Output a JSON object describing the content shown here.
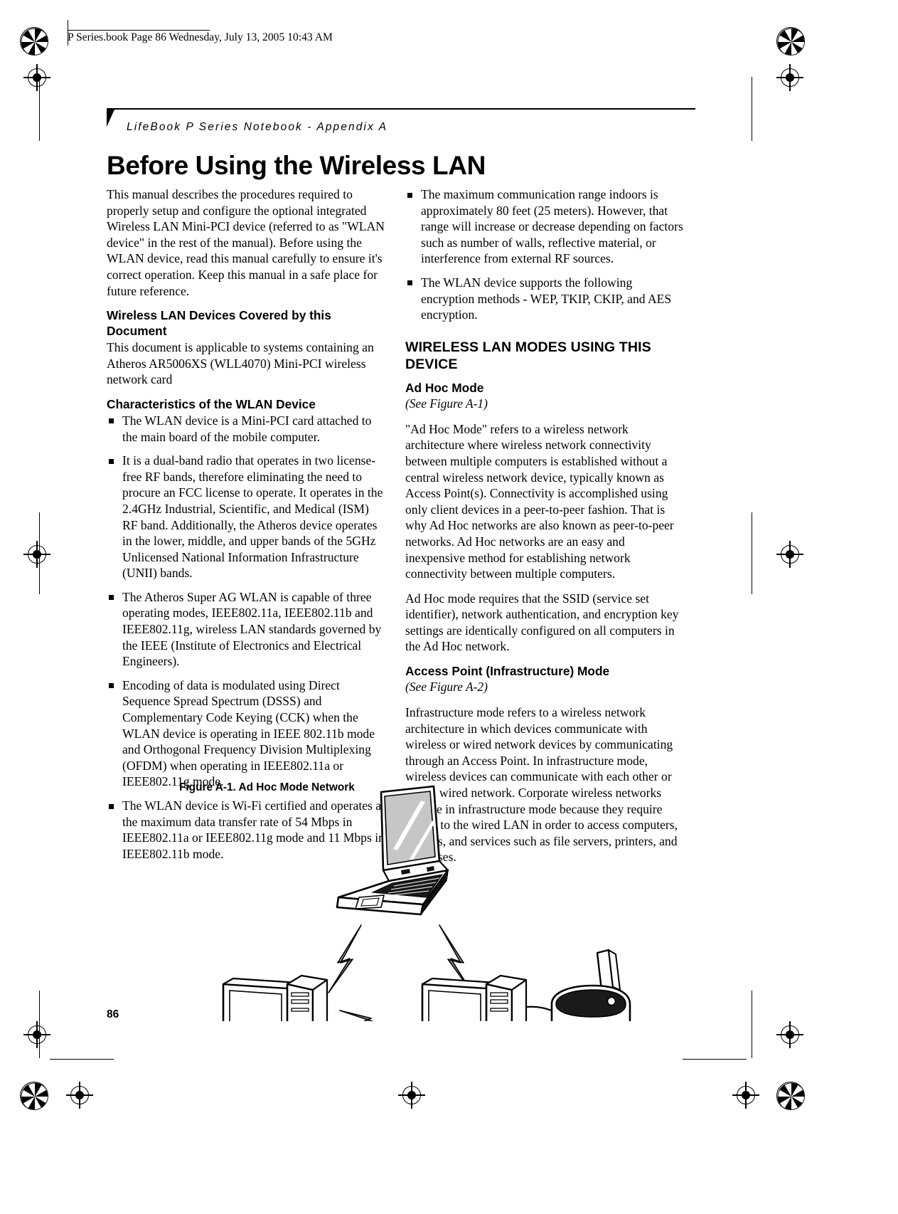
{
  "print_header": {
    "text": "P Series.book  Page 86  Wednesday, July 13, 2005  10:43 AM"
  },
  "running_head": "LifeBook P Series Notebook - Appendix A",
  "page_title": "Before Using the Wireless LAN",
  "page_number": "86",
  "left_column": {
    "intro_paragraph": "This manual describes the procedures required to properly setup and configure the optional integrated Wireless LAN Mini-PCI device (referred to as \"WLAN device\" in the rest of the manual). Before using the WLAN device, read this manual carefully to ensure it's correct operation. Keep this manual in a safe place for future reference.",
    "heading_devices_covered": "Wireless LAN Devices Covered by this Document",
    "devices_covered_paragraph": "This document is applicable to systems containing an Atheros AR5006XS (WLL4070) Mini-PCI wireless network card",
    "heading_characteristics": "Characteristics of the WLAN Device",
    "characteristics_bullets": [
      "The WLAN device is a Mini-PCI card attached to the main board of the mobile computer.",
      "It is a dual-band radio that operates in two license-free RF bands, therefore eliminating the need to procure an FCC license to operate. It operates in the 2.4GHz Industrial, Scientific, and Medical (ISM) RF band. Additionally, the Atheros device operates in the lower, middle, and upper bands of the 5GHz Unlicensed National Information Infrastructure (UNII) bands.",
      "The Atheros Super AG WLAN is capable of three operating modes, IEEE802.11a, IEEE802.11b and IEEE802.11g, wireless LAN standards governed by the IEEE (Institute of Electronics and Electrical Engineers).",
      "Encoding of data is modulated using Direct Sequence Spread Spectrum (DSSS) and Complementary Code Keying (CCK) when the WLAN device is operating in IEEE 802.11b mode and Orthogonal Frequency Division Multiplexing (OFDM) when operating in IEEE802.11a or IEEE802.11g mode.",
      "The WLAN device is Wi-Fi certified and operates at the maximum data transfer rate of 54 Mbps in IEEE802.11a or IEEE802.11g mode and 11 Mbps in IEEE802.11b mode."
    ]
  },
  "right_column": {
    "top_bullets": [
      "The maximum communication range indoors is approximately 80 feet (25 meters).   However, that range will increase or decrease depending on factors such as number of walls, reflective material, or interference from external RF sources.",
      "The WLAN device supports the following encryption methods - WEP, TKIP, CKIP, and AES encryption."
    ],
    "section_heading": "WIRELESS LAN MODES USING THIS DEVICE",
    "adhoc_heading": "Ad Hoc Mode",
    "adhoc_figref": "(See Figure A-1)",
    "adhoc_paragraph_1": "\"Ad Hoc Mode\" refers to a wireless network architecture where wireless network connectivity between multiple computers is established without a central wireless network device, typically known as Access Point(s). Connectivity is accomplished using only client devices in a peer-to-peer fashion. That is why Ad Hoc networks are also known as peer-to-peer networks. Ad Hoc networks are an easy and inexpensive method for establishing network connectivity between multiple computers.",
    "adhoc_paragraph_2": "Ad Hoc mode requires that the SSID (service set identifier), network authentication, and encryption key settings are identically configured on all computers in the Ad Hoc network.",
    "ap_heading": "Access Point (Infrastructure) Mode",
    "ap_figref": "(See Figure A-2)",
    "ap_paragraph": "Infrastructure mode refers to a wireless network architecture in which devices communicate with wireless or wired network devices by communicating through an Access Point. In infrastructure mode, wireless devices can communicate with each other or with a wired network. Corporate wireless networks operate in infrastructure mode because they require access to the wired LAN in order to access computers, devices, and services such as file servers, printers, and databases."
  },
  "figure": {
    "caption": "Figure A-1. Ad Hoc Mode Network",
    "icons": {
      "laptop": "laptop-icon",
      "desktop_left": "desktop-computer-icon",
      "desktop_right": "desktop-computer-icon",
      "printer": "printer-icon",
      "wireless_link": "lightning-bolt-icon"
    }
  },
  "colors": {
    "ink": "#000000",
    "paper": "#ffffff",
    "screen_fill": "#c6c6c6"
  }
}
